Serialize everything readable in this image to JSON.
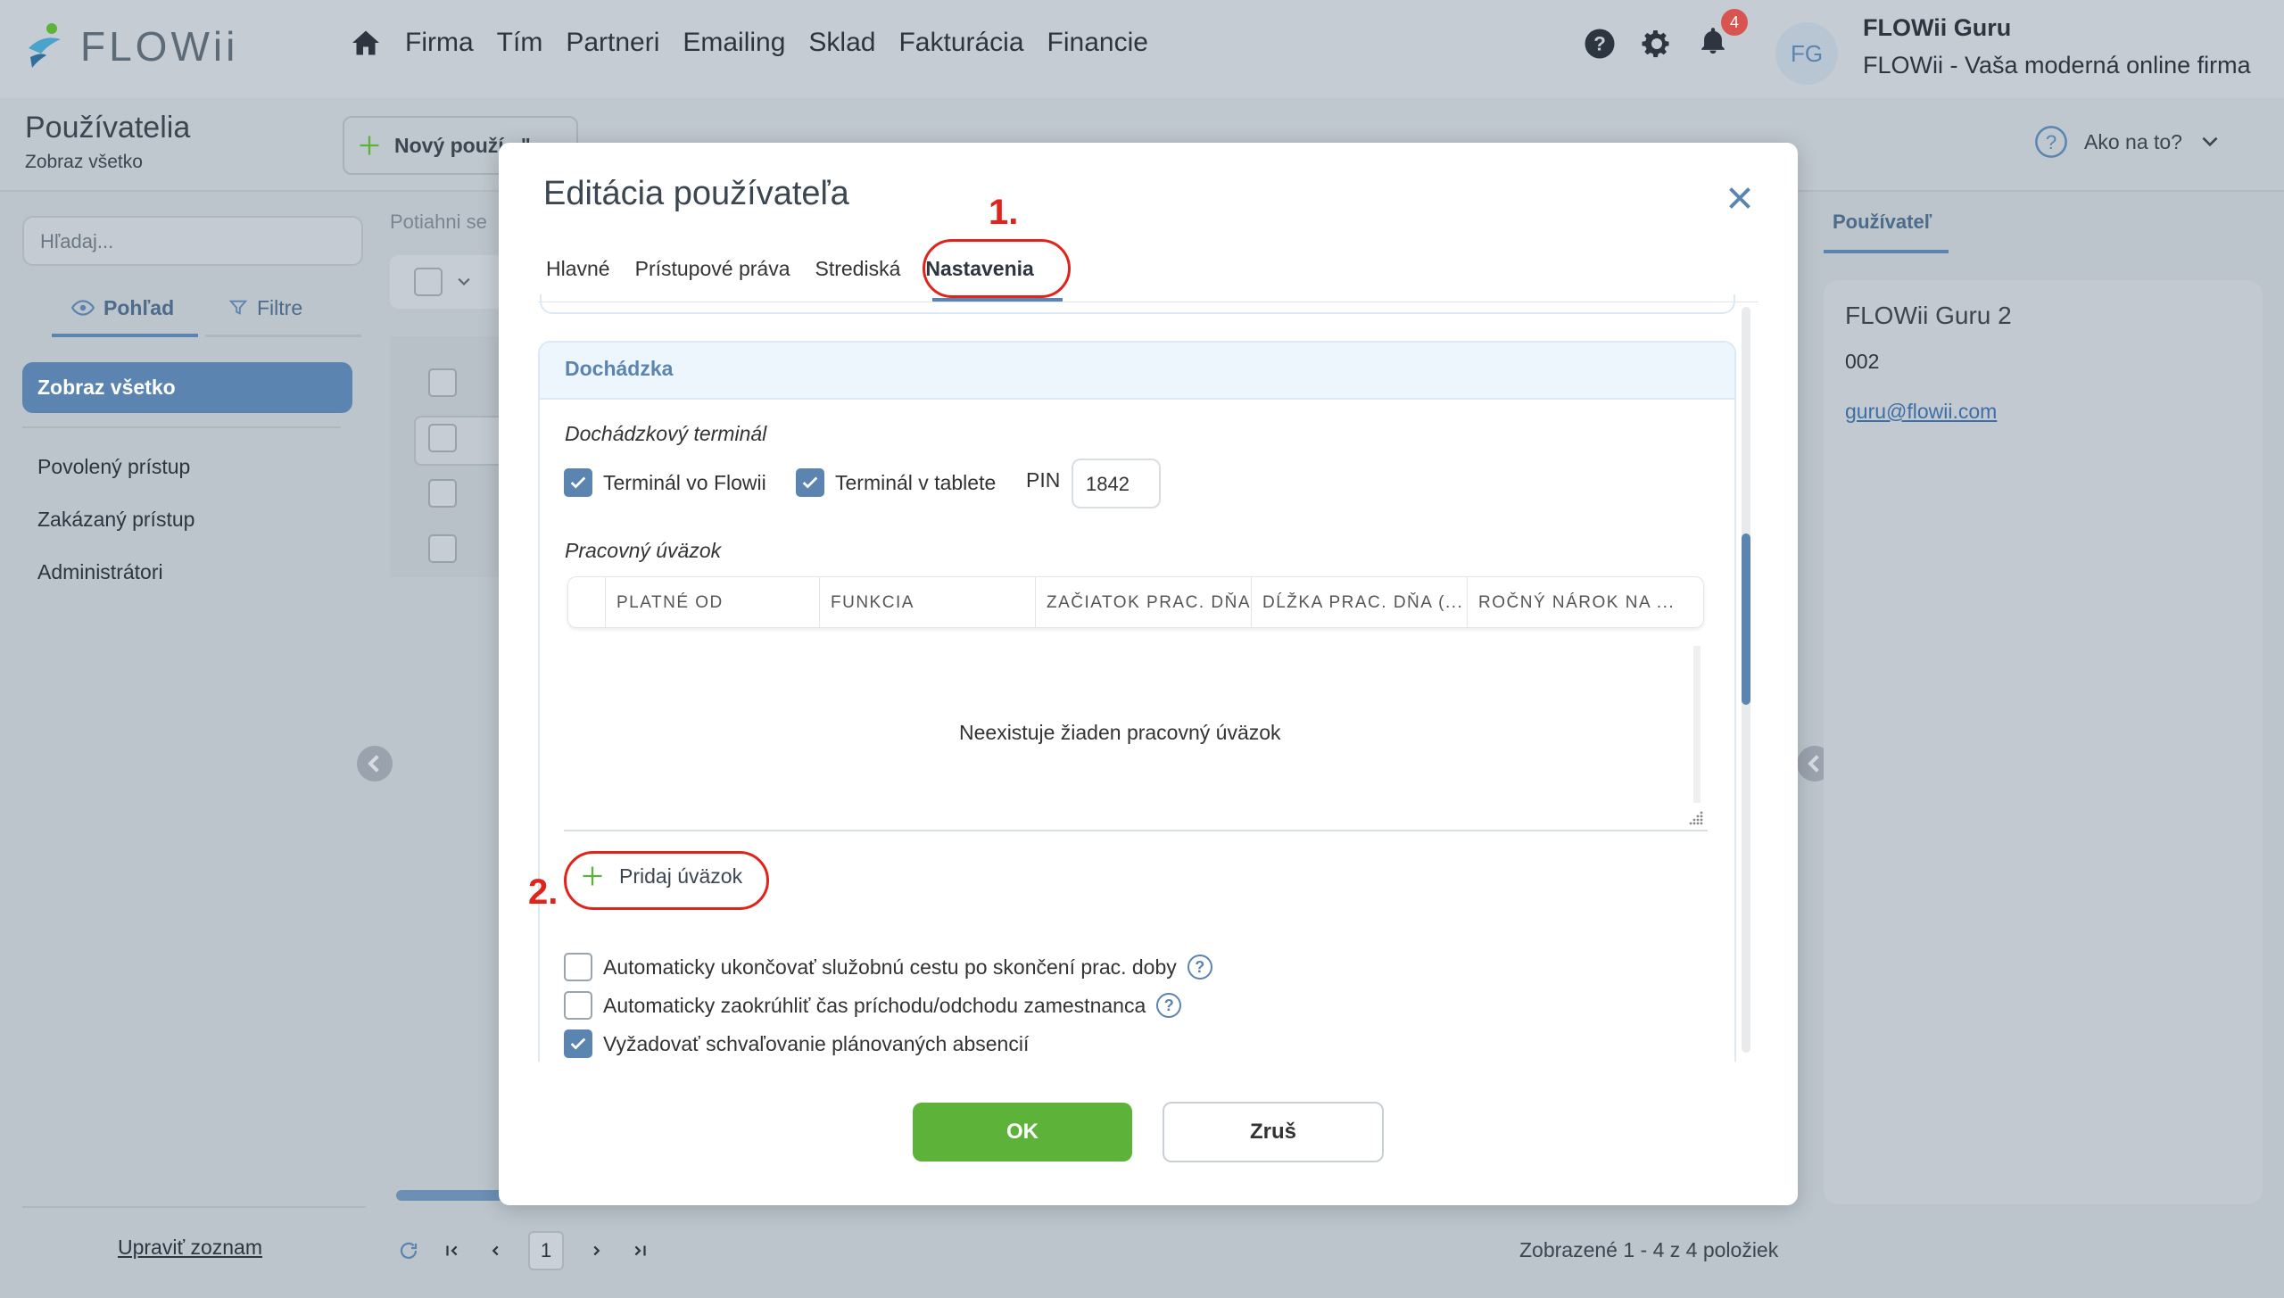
{
  "header": {
    "logo_text": "FLOWii",
    "nav": [
      "Firma",
      "Tím",
      "Partneri",
      "Emailing",
      "Sklad",
      "Fakturácia",
      "Financie"
    ],
    "notification_count": "4",
    "avatar_initials": "FG",
    "user_name": "FLOWii Guru",
    "company_name": "FLOWii - Vaša moderná online firma"
  },
  "subheader": {
    "title": "Používatelia",
    "subtitle": "Zobraz všetko",
    "new_button": "Nový použí...\"",
    "help_label": "Ako na to?"
  },
  "sidebar": {
    "search_placeholder": "Hľadaj...",
    "tab_view": "Pohľad",
    "tab_filter": "Filtre",
    "active_item": "Zobraz všetko",
    "items": [
      "Povolený prístup",
      "Zakázaný prístup",
      "Administrátori"
    ],
    "edit_list": "Upraviť zoznam"
  },
  "list": {
    "drag_hint": "Potiahni se"
  },
  "right_panel": {
    "tab": "Používateľ",
    "name": "FLOWii Guru 2",
    "number": "002",
    "email": "guru@flowii.com"
  },
  "footer": {
    "current_page": "1",
    "info": "Zobrazené 1 - 4 z 4 položiek"
  },
  "dialog": {
    "title": "Editácia používateľa",
    "tabs": [
      "Hlavné",
      "Prístupové práva",
      "Strediská",
      "Nastavenia"
    ],
    "active_tab": "Nastavenia",
    "annotation_1": "1.",
    "annotation_2": "2.",
    "section_title": "Dochádzka",
    "terminal_label": "Dochádzkový terminál",
    "terminal_flowii": "Terminál vo Flowii",
    "terminal_tablet": "Terminál v tablete",
    "pin_label": "PIN",
    "pin_value": "1842",
    "workload_label": "Pracovný úväzok",
    "table_columns": [
      "PLATNÉ OD",
      "FUNKCIA",
      "ZAČIATOK PRAC. DŇA",
      "DĹŽKA PRAC. DŇA (...",
      "ROČNÝ NÁROK NA ..."
    ],
    "table_empty": "Neexistuje žiaden pracovný úväzok",
    "add_workload": "Pridaj úväzok",
    "options": [
      {
        "label": "Automaticky ukončovať služobnú cestu po skončení prac. doby",
        "checked": false,
        "help": true
      },
      {
        "label": "Automaticky zaokrúhliť čas príchodu/odchodu zamestnanca",
        "checked": false,
        "help": true
      },
      {
        "label": "Vyžadovať schvaľovanie plánovaných absencií",
        "checked": true,
        "help": false
      }
    ],
    "ok_label": "OK",
    "cancel_label": "Zruš"
  },
  "colors": {
    "accent": "#5b84b0",
    "ok_green": "#5db33a",
    "annotation_red": "#e0231b",
    "badge_red": "#d9534f"
  }
}
